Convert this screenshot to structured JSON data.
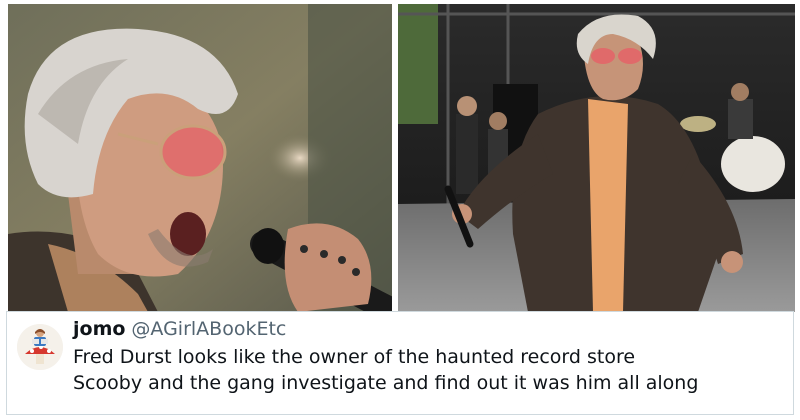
{
  "images": {
    "left_alt": "",
    "right_alt": ""
  },
  "tweet": {
    "display_name": "jomo",
    "handle": "@AGirlABookEtc",
    "lines": [
      "Fred Durst looks like the owner of the haunted record store",
      "Scooby and the gang investigate and find out it was him all along"
    ]
  },
  "colors": {
    "name": "#0f1419",
    "handle": "#536471",
    "text": "#0f1419",
    "border": "#cfd9de"
  }
}
